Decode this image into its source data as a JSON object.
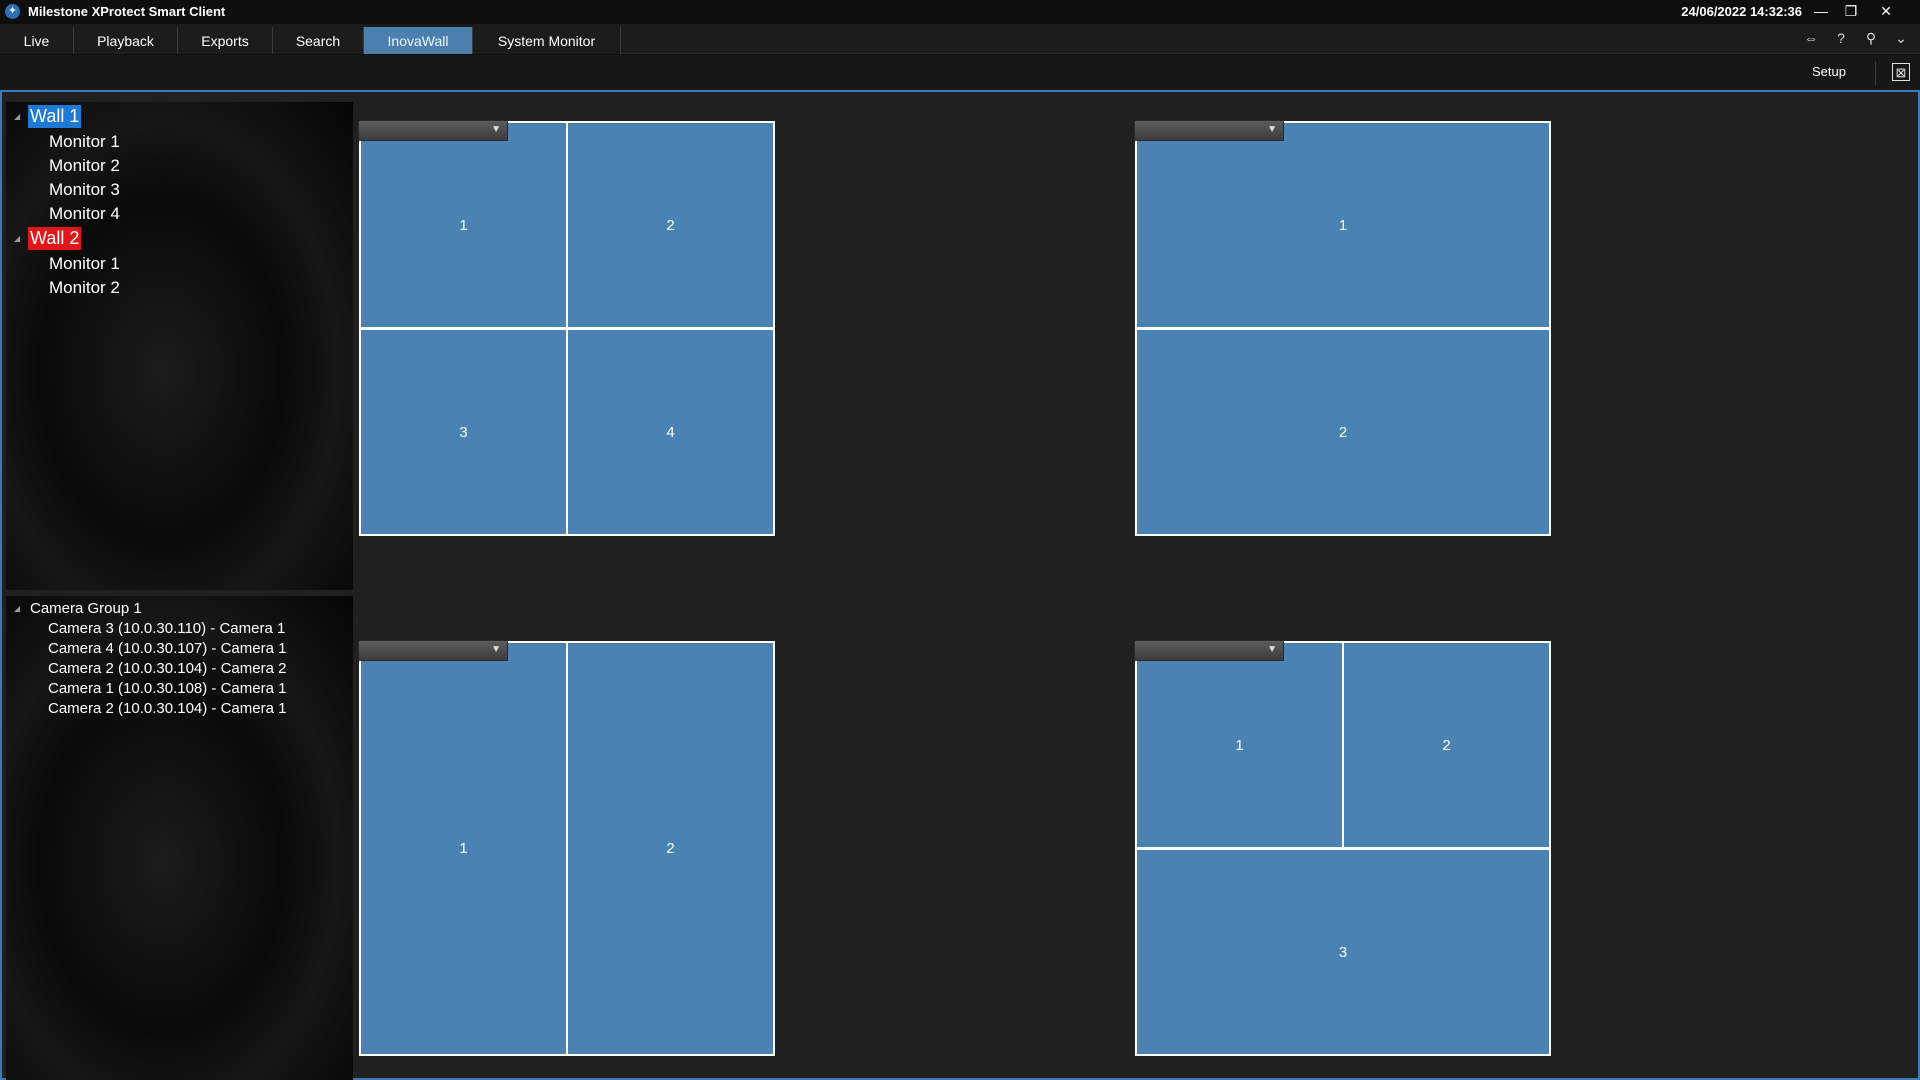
{
  "app": {
    "title": "Milestone XProtect Smart Client",
    "clock": "24/06/2022 14:32:36",
    "window_controls": {
      "minimize": "—",
      "restore": "❐",
      "close": "✕"
    }
  },
  "tabs": [
    {
      "label": "Live",
      "active": false
    },
    {
      "label": "Playback",
      "active": false
    },
    {
      "label": "Exports",
      "active": false
    },
    {
      "label": "Search",
      "active": false
    },
    {
      "label": "InovaWall",
      "active": true
    },
    {
      "label": "System Monitor",
      "active": false
    }
  ],
  "top_icons": [
    "connection-icon",
    "help-icon",
    "login-icon",
    "chevron-down-icon"
  ],
  "toolbar": {
    "setup_label": "Setup",
    "expand_icon": "maximize-icon"
  },
  "walls_tree": {
    "walls": [
      {
        "label": "Wall 1",
        "selection_color": "#1f7ad6",
        "monitors": [
          "Monitor 1",
          "Monitor 2",
          "Monitor 3",
          "Monitor 4"
        ]
      },
      {
        "label": "Wall 2",
        "selection_color": "#e0161b",
        "monitors": [
          "Monitor 1",
          "Monitor 2"
        ]
      }
    ]
  },
  "camera_tree": {
    "group_label": "Camera Group 1",
    "cameras": [
      "Camera 3 (10.0.30.110) - Camera 1",
      "Camera 4 (10.0.30.107) - Camera 1",
      "Camera 2 (10.0.30.104) - Camera 2",
      "Camera 1 (10.0.30.108) - Camera 1",
      "Camera 2 (10.0.30.104) - Camera 1"
    ]
  },
  "monitors": [
    {
      "layout": "2x2",
      "cells": [
        "1",
        "2",
        "3",
        "4"
      ]
    },
    {
      "layout": "2 rows",
      "cells": [
        "1",
        "2"
      ]
    },
    {
      "layout": "2 columns",
      "cells": [
        "1",
        "2"
      ]
    },
    {
      "layout": "2 top + 1 bottom",
      "cells": [
        "1",
        "2",
        "3"
      ]
    }
  ],
  "colors": {
    "accent": "#4a7fae",
    "cell": "#4a82b4",
    "border": "#3d7ab3"
  }
}
